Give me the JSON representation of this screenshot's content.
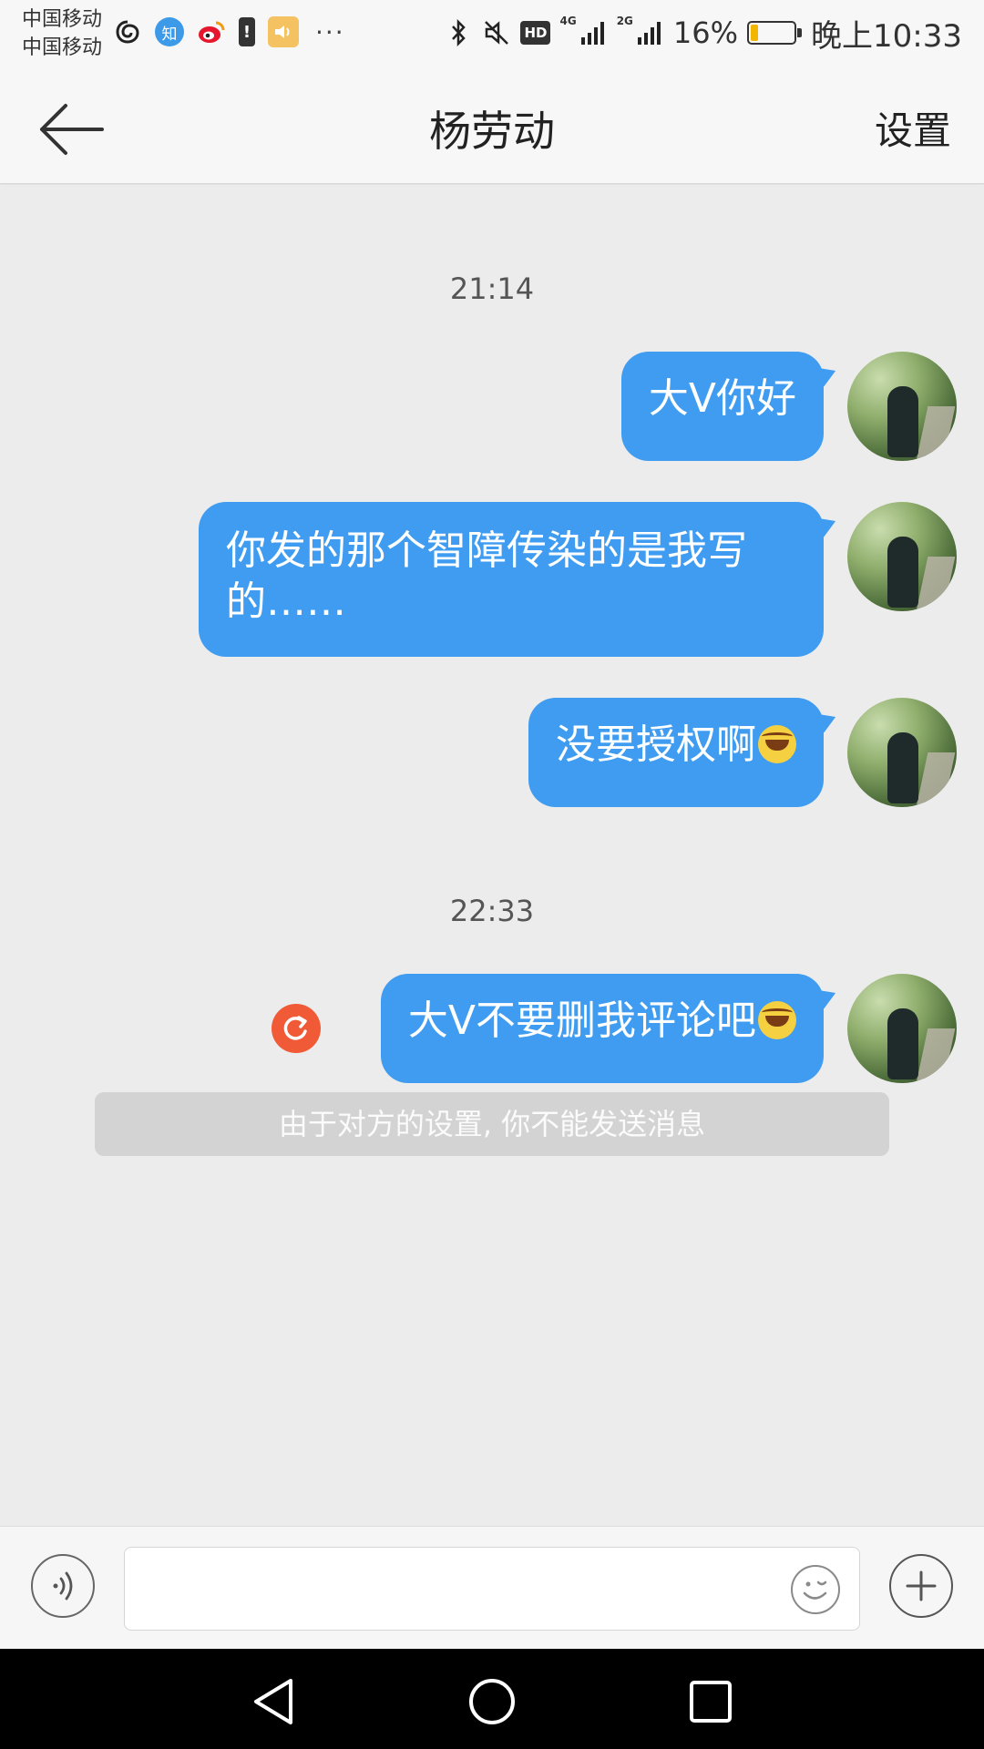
{
  "status_bar": {
    "carrier_1": "中国移动",
    "carrier_2": "中国移动",
    "zhi_label": "知",
    "more": "···",
    "hd": "HD",
    "net_1": "4G",
    "net_2": "2G",
    "battery_percent": "16%",
    "battery_level": 0.16,
    "time": "晚上10:33",
    "icons": [
      "netease-icon",
      "zhihu-icon",
      "weibo-icon",
      "battery-alert-icon",
      "sound-app-icon",
      "bluetooth-icon",
      "mute-icon",
      "signal-icon",
      "signal-icon",
      "battery-icon"
    ]
  },
  "nav": {
    "title": "杨劳动",
    "settings": "设置"
  },
  "chat": {
    "bubble_color": "#3f9cf1",
    "groups": [
      {
        "time": "21:14"
      },
      {
        "time": "22:33"
      }
    ],
    "messages": [
      {
        "text": "大V你好",
        "emoji": false
      },
      {
        "text": "你发的那个智障传染的是我写的……",
        "emoji": false
      },
      {
        "text": "没要授权啊",
        "emoji": true
      },
      {
        "text": "大V不要删我评论吧",
        "emoji": true,
        "failed": true
      }
    ],
    "notice": "由于对方的设置, 你不能发送消息"
  },
  "input": {
    "value": "",
    "placeholder": ""
  }
}
